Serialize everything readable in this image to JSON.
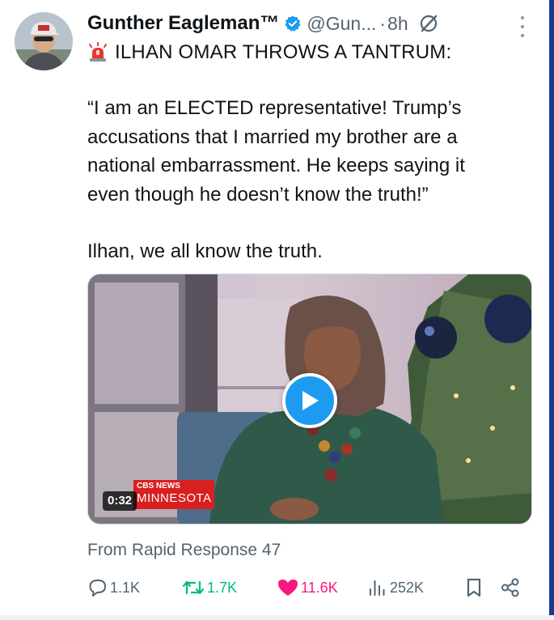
{
  "post": {
    "display_name": "Gunther Eagleman™",
    "handle": "@Gun...",
    "separator": "·",
    "time": "8h",
    "headline": "ILHAN OMAR THROWS A TANTRUM:",
    "body_lines": [
      "“I am an ELECTED representative! Trump’s",
      "accusations that I married my brother are a",
      "national embarrassment. He keeps saying it",
      "even though he doesn’t know the truth!”"
    ],
    "closing_line": "Ilhan,  we all know the truth.",
    "source": "From Rapid Response 47"
  },
  "video": {
    "duration": "0:32",
    "network": "CBS NEWS",
    "region": "MINNESOTA"
  },
  "actions": {
    "replies": "1.1K",
    "reposts": "1.7K",
    "likes": "11.6K",
    "views": "252K"
  },
  "icons": {
    "verified": "verified-badge-icon",
    "grok": "grok-icon",
    "more": "more-options-icon",
    "siren": "siren-emoji-icon",
    "play": "play-icon",
    "reply": "reply-icon",
    "repost": "repost-icon",
    "like": "heart-icon",
    "views": "views-icon",
    "bookmark": "bookmark-icon",
    "share": "share-icon"
  },
  "colors": {
    "accent": "#1d9bf0",
    "repost": "#00ba7c",
    "like": "#f91880",
    "secondary_text": "#536471"
  }
}
